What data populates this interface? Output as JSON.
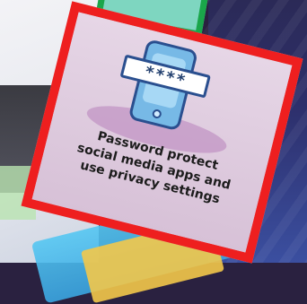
{
  "card": {
    "password_masked": "****",
    "caption": "Password protect\nsocial media apps and\nuse privacy settings"
  },
  "icons": {
    "phone": "phone-icon",
    "password_field": "password-field-icon"
  },
  "colors": {
    "card_border": "#EE1F1F",
    "card_bg": "#D9C9DA",
    "phone_fill": "#77B9E6",
    "phone_stroke": "#2A4F8F",
    "top_card_border": "#1AA64A",
    "top_card_fill": "#7ED6C0"
  }
}
